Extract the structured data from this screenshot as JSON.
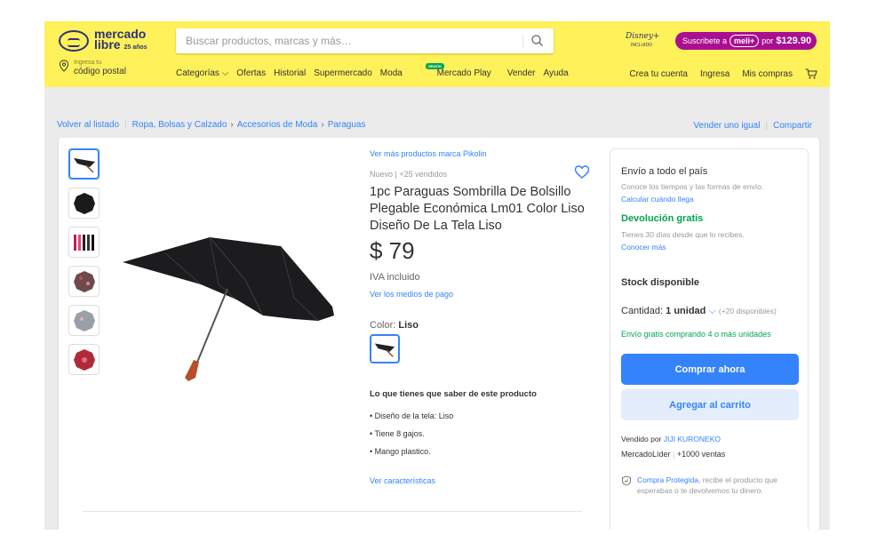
{
  "header": {
    "logo_line1": "mercado",
    "logo_line2": "libre",
    "logo_years": "25 años",
    "search_placeholder": "Buscar productos, marcas y más…",
    "disney_label": "Disney+",
    "disney_included": "INCLUIDO",
    "meli_prefix": "Suscribete a",
    "meli_badge": "meli+",
    "meli_price_prefix": "por",
    "meli_price": "$129.90",
    "postal_small": "Ingresa tu",
    "postal_main": "código postal",
    "nav": {
      "categorias": "Categorías ⌵",
      "ofertas": "Ofertas",
      "historial": "Historial",
      "supermercado": "Supermercado",
      "moda": "Moda",
      "mercado_play": "Mercado Play",
      "gratis": "GRATIS",
      "vender": "Vender",
      "ayuda": "Ayuda"
    },
    "nav_right": {
      "crear_cuenta": "Crea tu cuenta",
      "ingresa": "Ingresa",
      "mis_compras": "Mis compras"
    }
  },
  "breadcrumb": {
    "back": "Volver al listado",
    "items": [
      "Ropa, Bolsas y Calzado",
      "Accesorios de Moda",
      "Paraguas"
    ],
    "vender_igual": "Vender uno igual",
    "compartir": "Compartir"
  },
  "product": {
    "brand_link": "Ver más productos marca Pikolin",
    "condition": "Nuevo",
    "sold": "+25 vendidos",
    "title": "1pc Paraguas Sombrilla De Bolsillo Plegable Económica Lm01 Color Liso Diseño De La Tela Liso",
    "price": "$ 79",
    "iva": "IVA incluido",
    "payment_link": "Ver los medios de pago",
    "color_label": "Color:",
    "color_value": "Liso",
    "know_title": "Lo que tienes que saber de este producto",
    "features": [
      "Diseño de la tela: Liso",
      "Tiene 8 gajos.",
      "Mango plastico."
    ],
    "characteristics_link": "Ver características"
  },
  "buybox": {
    "shipping_title": "Envío a todo el país",
    "shipping_sub": "Conoce los tiempos y las formas de envío.",
    "shipping_link": "Calcular cuándo llega",
    "return_title": "Devolución gratis",
    "return_sub": "Tienes 30 días desde que lo recibes.",
    "return_link": "Conocer más",
    "stock": "Stock disponible",
    "quantity_label": "Cantidad:",
    "quantity_value": "1 unidad",
    "quantity_available": "(+20 disponibles)",
    "free_shipping": "Envío gratis comprando 4 o más unidades",
    "buy_now": "Comprar ahora",
    "add_cart": "Agregar al carrito",
    "sold_by_prefix": "Vendido por",
    "seller": "JIJI KURONEKO",
    "seller_level": "MercadoLíder",
    "seller_sales": "+1000 ventas",
    "protected_link": "Compra Protegida",
    "protected_text": ", recibe el producto que esperabas o te devolvemos tu dinero."
  },
  "colors": {
    "header_bg": "#fff159",
    "link": "#3483fa",
    "green": "#00a650",
    "meli_purple": "#a90f90"
  }
}
